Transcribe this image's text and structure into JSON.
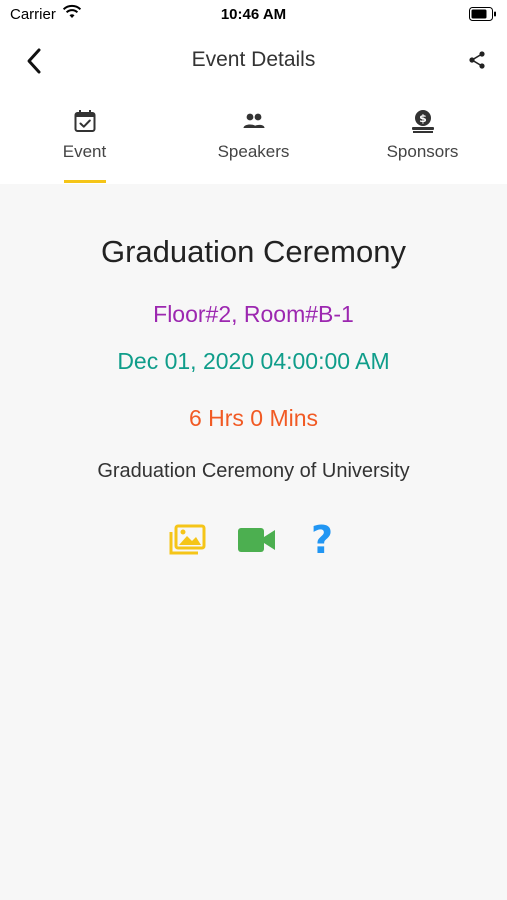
{
  "status_bar": {
    "carrier": "Carrier",
    "time": "10:46 AM"
  },
  "header": {
    "title": "Event Details",
    "back_icon": "chevron-left-icon",
    "share_icon": "share-icon"
  },
  "tabs": [
    {
      "label": "Event",
      "icon": "calendar-check-icon",
      "selected": true
    },
    {
      "label": "Speakers",
      "icon": "people-icon",
      "selected": false
    },
    {
      "label": "Sponsors",
      "icon": "money-hand-icon",
      "selected": false
    }
  ],
  "event": {
    "title": "Graduation Ceremony",
    "location": "Floor#2, Room#B-1",
    "datetime": "Dec 01, 2020 04:00:00 AM",
    "duration": "6 Hrs 0 Mins",
    "description": "Graduation Ceremony of University"
  },
  "actions": [
    {
      "icon": "photo-gallery-icon",
      "color": "#f5c518"
    },
    {
      "icon": "video-camera-icon",
      "color": "#4caf50"
    },
    {
      "icon": "question-mark-icon",
      "color": "#2196f3"
    }
  ],
  "colors": {
    "tab_indicator": "#f5c518",
    "location": "#9c27b0",
    "datetime": "#0f9d8a",
    "duration": "#f15a24"
  }
}
